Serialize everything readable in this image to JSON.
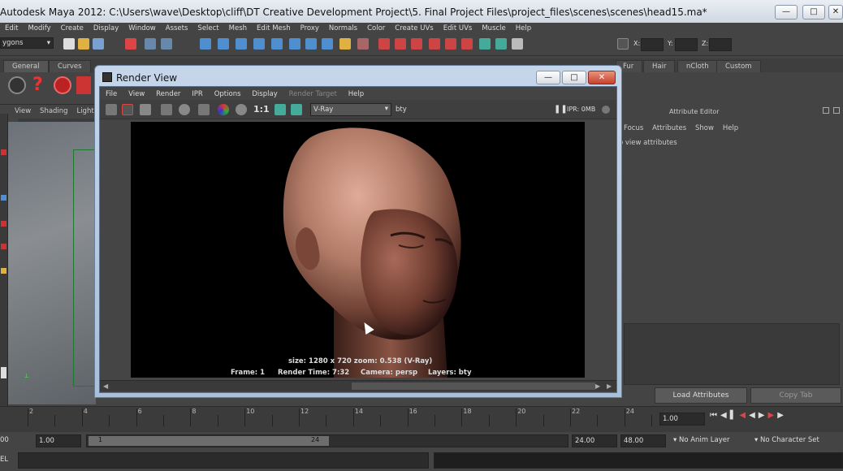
{
  "app": {
    "title": "Autodesk Maya 2012: C:\\Users\\wave\\Desktop\\cliff\\DT Creative Development Project\\5. Final Project Files\\project_files\\scenes\\scenes\\head15.ma*"
  },
  "main_menu": [
    "Edit",
    "Modify",
    "Create",
    "Display",
    "Window",
    "Assets",
    "Select",
    "Mesh",
    "Edit Mesh",
    "Proxy",
    "Normals",
    "Color",
    "Create UVs",
    "Edit UVs",
    "Muscle",
    "Help"
  ],
  "status_line": {
    "mode": "ygons",
    "coord_labels": [
      "X:",
      "Y:",
      "Z:"
    ]
  },
  "shelf": {
    "tabs_left": [
      "General",
      "Curves"
    ],
    "tabs_right": [
      "Fur",
      "Hair",
      "nCloth",
      "Custom"
    ]
  },
  "viewport_panel": {
    "menu": [
      "View",
      "Shading",
      "Lightin"
    ]
  },
  "attribute_editor": {
    "title": "Attribute Editor",
    "menu": [
      "Focus",
      "Attributes",
      "Show",
      "Help"
    ],
    "hint": "o view attributes",
    "load_button": "Load Attributes",
    "copy_button": "Copy Tab"
  },
  "render_view": {
    "title": "Render View",
    "menu": [
      "File",
      "View",
      "Render",
      "IPR",
      "Options",
      "Display",
      "Render Target",
      "Help"
    ],
    "ratio_label": "1:1",
    "renderer": "V-Ray",
    "channel": "bty",
    "ipr_status": "IPR: 0MB",
    "info_line1": "size: 1280 x 720 zoom: 0.538        (V-Ray)",
    "frame": "Frame: 1",
    "render_time": "Render Time:  7:32",
    "camera": "Camera: persp",
    "layers": "Layers: bty"
  },
  "time_slider": {
    "ticks": [
      "2",
      "4",
      "6",
      "8",
      "10",
      "12",
      "14",
      "16",
      "18",
      "20",
      "22",
      "24"
    ],
    "current_time": "1.00"
  },
  "range_slider": {
    "start_left": "00",
    "start": "1.00",
    "range_start": "1",
    "range_end": "24",
    "end": "24.00",
    "end_max": "48.00",
    "anim_layer": "No Anim Layer",
    "char_set": "No Character Set"
  },
  "command_line": {
    "label": "EL"
  },
  "colors": {
    "window_chrome": "#c6d6ea",
    "close_button": "#c8412c",
    "ui_background": "#444444",
    "skin": "#b07a66"
  }
}
